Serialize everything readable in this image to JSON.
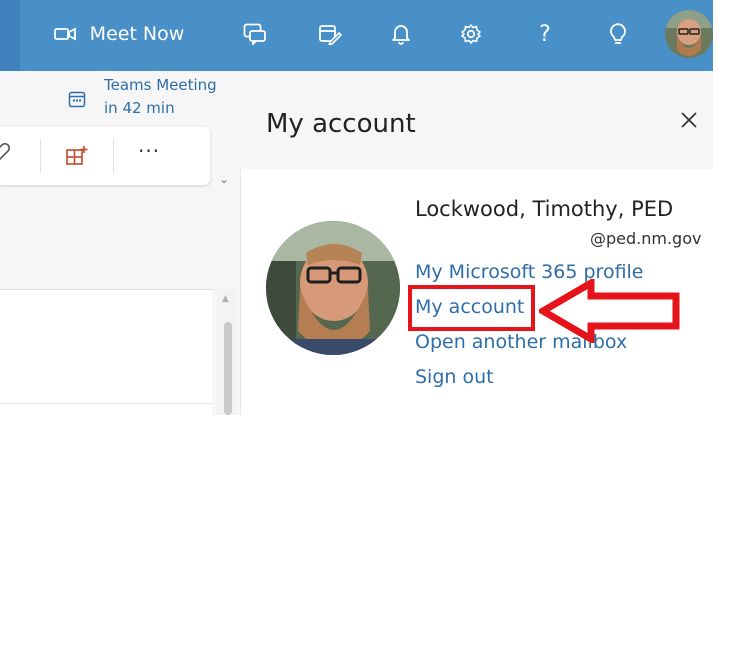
{
  "topbar": {
    "meet_now_label": "Meet Now",
    "icons": [
      "video-camera-icon",
      "chat-feedback-icon",
      "calendar-edit-icon",
      "bell-icon",
      "gear-icon",
      "help-icon",
      "lightbulb-icon"
    ],
    "accent_color": "#4a90c8"
  },
  "teams_meeting": {
    "title": "Teams Meeting",
    "time": "in 42 min"
  },
  "ribbon": {
    "more_label": "···"
  },
  "account_panel": {
    "title": "My account",
    "user_name": "Lockwood, Timothy, PED",
    "user_email": "@ped.nm.gov",
    "links": [
      "My Microsoft 365 profile",
      "My account",
      "Open another mailbox",
      "Sign out"
    ],
    "link_color": "#2e6ea8",
    "highlight_color": "#e5141b"
  }
}
